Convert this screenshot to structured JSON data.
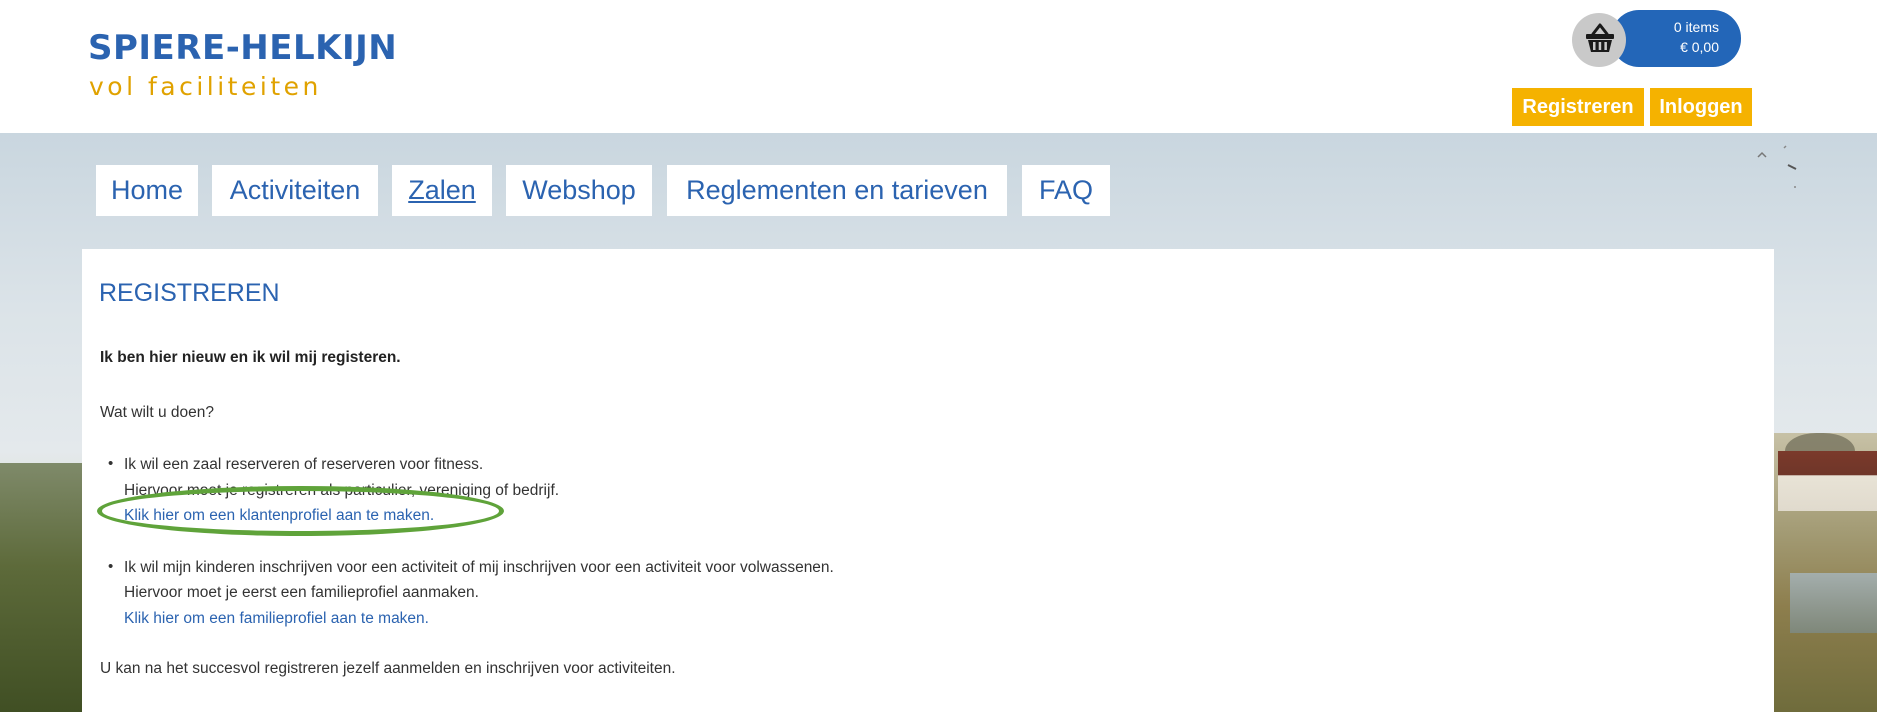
{
  "header": {
    "logo_title": "SPIERE-HELKIJN",
    "logo_tagline": "vol faciliteiten",
    "cart": {
      "items_label": "0 items",
      "total_label": "€ 0,00",
      "icon": "basket-icon"
    },
    "register_label": "Registreren",
    "login_label": "Inloggen"
  },
  "nav": {
    "items": [
      {
        "label": "Home"
      },
      {
        "label": "Activiteiten"
      },
      {
        "label": "Zalen",
        "active": true
      },
      {
        "label": "Webshop"
      },
      {
        "label": "Reglementen en tarieven"
      },
      {
        "label": "FAQ"
      }
    ]
  },
  "content": {
    "title": "REGISTREREN",
    "intro": "Ik ben hier nieuw en ik wil mij registeren.",
    "question": "Wat wilt u doen?",
    "options": [
      {
        "line1": "Ik wil een zaal reserveren of reserveren voor fitness.",
        "line2": "Hiervoor moet je registreren als particulier, vereniging of bedrijf.",
        "link": "Klik hier om een klantenprofiel aan te maken."
      },
      {
        "line1": "Ik wil mijn kinderen inschrijven voor een activiteit of mij inschrijven voor een activiteit voor volwassenen.",
        "line2": "Hiervoor moet je eerst een familieprofiel aanmaken.",
        "link": "Klik hier om een familieprofiel aan te maken."
      }
    ],
    "footer_text": "U kan na het succesvol registreren jezelf aanmelden en inschrijven voor activiteiten."
  },
  "colors": {
    "brand_blue": "#2b63b0",
    "accent_yellow": "#f5b200",
    "highlight_green": "#5fa33a"
  }
}
